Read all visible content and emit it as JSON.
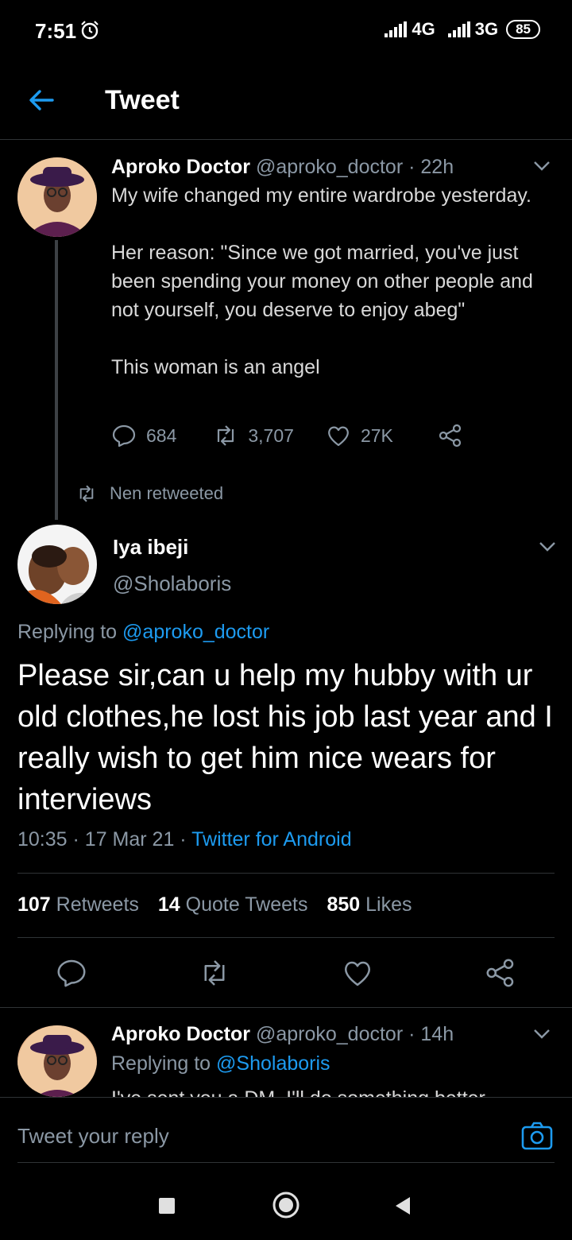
{
  "status_bar": {
    "time": "7:51",
    "network_1": "4G",
    "network_2": "3G",
    "battery": "85"
  },
  "header": {
    "title": "Tweet"
  },
  "tweet_parent": {
    "name": "Aproko Doctor",
    "handle": "@aproko_doctor",
    "age": "· 22h",
    "text": "My wife changed my entire wardrobe yesterday.\n\nHer reason: \"Since we got married, you've just been spending your money on other people and not yourself, you deserve to enjoy abeg\"\n\nThis woman is an angel",
    "replies": "684",
    "retweets": "3,707",
    "likes": "27K"
  },
  "retweet_banner": "Nen retweeted",
  "tweet_main": {
    "name": "Iya ibeji",
    "handle": "@Sholaboris",
    "replying_label": "Replying to",
    "replying_handle": "@aproko_doctor",
    "text": "Please sir,can u help my hubby with ur old clothes,he lost his job last year and I really wish to get him nice wears for interviews",
    "time": "10:35",
    "date": "· 17 Mar 21 ·",
    "source": "Twitter for Android",
    "retweets_count": "107",
    "retweets_label": "Retweets",
    "quotes_count": "14",
    "quotes_label": "Quote Tweets",
    "likes_count": "850",
    "likes_label": "Likes"
  },
  "tweet_reply": {
    "name": "Aproko Doctor",
    "handle": "@aproko_doctor",
    "age": "· 14h",
    "replying_label": "Replying to",
    "replying_handle": "@Sholaboris",
    "text": "I've sent you a DM. I'll do something better"
  },
  "reply_box": {
    "placeholder": "Tweet your reply"
  },
  "icons": {
    "alarm": "alarm-icon",
    "back": "back-arrow-icon",
    "chevron": "chevron-down-icon",
    "reply": "reply-icon",
    "retweet": "retweet-icon",
    "like": "heart-icon",
    "share": "share-icon",
    "camera": "camera-icon"
  },
  "colors": {
    "background": "#000000",
    "accent": "#1d9bf0",
    "muted": "#8b98a5",
    "text": "#d9d9d9",
    "divider": "#2f3336"
  }
}
